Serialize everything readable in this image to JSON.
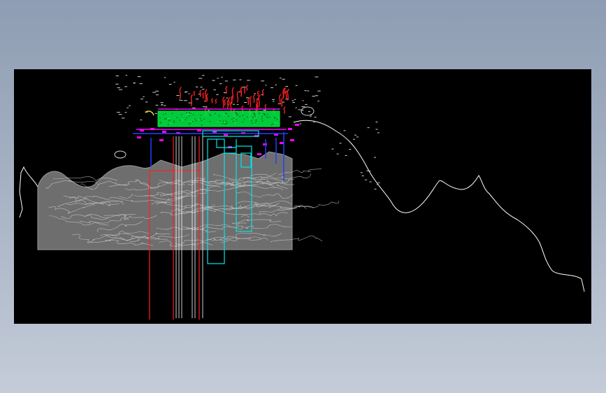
{
  "viewer": {
    "background_top": "#8e9db3",
    "background_bottom": "#c4ccd8",
    "canvas_background": "#000000"
  },
  "drawing": {
    "layer_colors": {
      "terrain": "#9a9a9a",
      "terrain_fill": "#6e6e6e",
      "contour": "#cfcfcf",
      "outline": "#ffffff",
      "annotation": "#ff2020",
      "vegetation": "#00ee44",
      "water": "#00e5e5",
      "structure": "#2040ff",
      "marker": "#ff00ff",
      "highlight": "#ffff40"
    }
  }
}
